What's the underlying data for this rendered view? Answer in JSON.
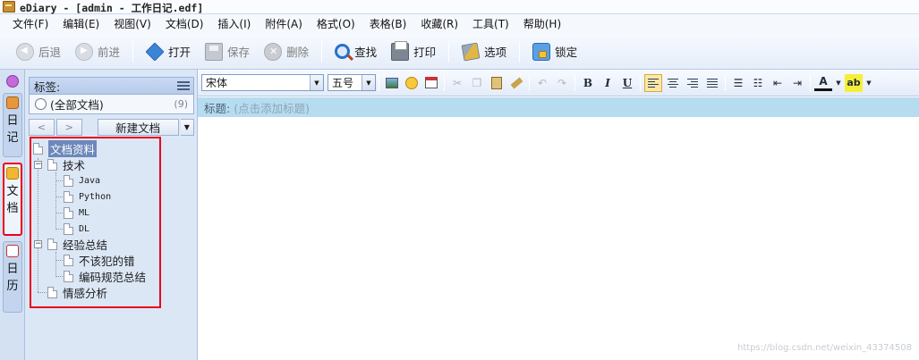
{
  "window": {
    "title": "eDiary - [admin - 工作日记.edf]"
  },
  "menu": [
    "文件(F)",
    "编辑(E)",
    "视图(V)",
    "文档(D)",
    "插入(I)",
    "附件(A)",
    "格式(O)",
    "表格(B)",
    "收藏(R)",
    "工具(T)",
    "帮助(H)"
  ],
  "toolbar": {
    "back": "后退",
    "forward": "前进",
    "open": "打开",
    "save": "保存",
    "delete": "删除",
    "find": "查找",
    "print": "打印",
    "options": "选项",
    "lock": "锁定"
  },
  "left_tabs": {
    "diary": [
      "日",
      "记"
    ],
    "docs": [
      "文",
      "档"
    ],
    "calendar": [
      "日",
      "历"
    ]
  },
  "panel": {
    "tags_label": "标签:",
    "all_docs": "(全部文档)",
    "all_docs_count": "(9)",
    "prev": "<",
    "next": ">",
    "new_doc": "新建文档",
    "dropdown": "▼"
  },
  "tree": {
    "root": "文档资料",
    "items": [
      {
        "label": "技术",
        "children": [
          "Java",
          "Python",
          "ML",
          "DL"
        ]
      },
      {
        "label": "经验总结",
        "children": [
          "不该犯的错",
          "编码规范总结"
        ]
      },
      {
        "label": "情感分析",
        "children": []
      }
    ]
  },
  "format": {
    "font": "宋体",
    "size": "五号",
    "bold": "B",
    "italic": "I",
    "underline": "U",
    "font_color": "A",
    "highlight": "ab"
  },
  "editor": {
    "title_label": "标题:",
    "title_placeholder": "(点击添加标题)"
  },
  "watermark": "https://blog.csdn.net/weixin_43374508",
  "colors": {
    "accent": "#e8001c",
    "title_bar_bg": "#b6dcf0",
    "selected": "#6d88ba"
  }
}
